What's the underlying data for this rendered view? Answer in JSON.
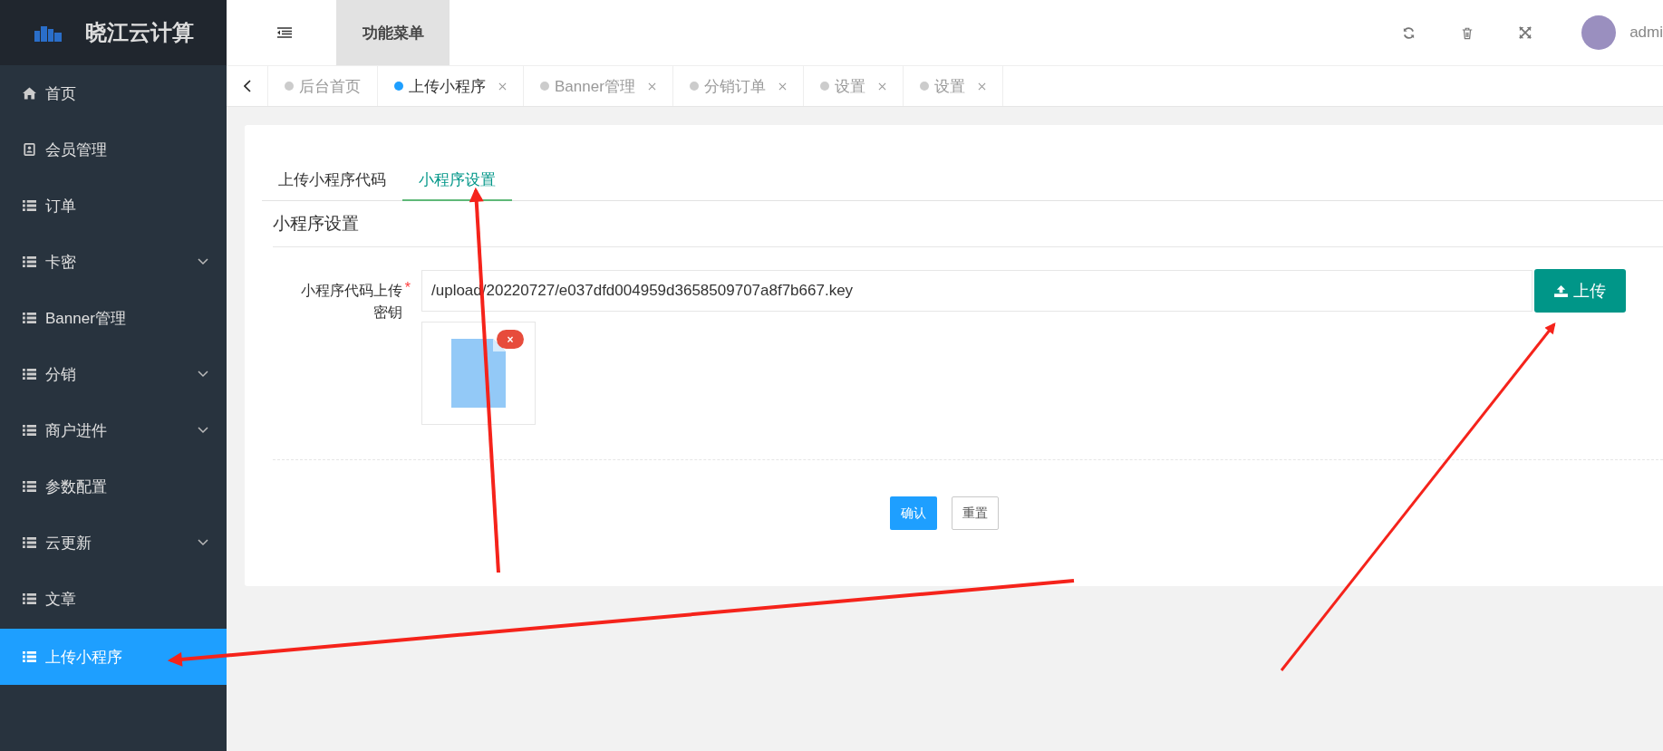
{
  "brand": {
    "title": "晓江云计算"
  },
  "header": {
    "menu_label": "功能菜单",
    "user": "admi"
  },
  "sidebar": {
    "items": [
      {
        "label": "首页",
        "kind": "home",
        "expandable": false,
        "selected": false
      },
      {
        "label": "会员管理",
        "kind": "contact",
        "expandable": false,
        "selected": false
      },
      {
        "label": "订单",
        "kind": "list",
        "expandable": false,
        "selected": false
      },
      {
        "label": "卡密",
        "kind": "list",
        "expandable": true,
        "selected": false
      },
      {
        "label": "Banner管理",
        "kind": "list",
        "expandable": false,
        "selected": false
      },
      {
        "label": "分销",
        "kind": "list",
        "expandable": true,
        "selected": false
      },
      {
        "label": "商户进件",
        "kind": "list",
        "expandable": true,
        "selected": false
      },
      {
        "label": "参数配置",
        "kind": "list",
        "expandable": false,
        "selected": false
      },
      {
        "label": "云更新",
        "kind": "list",
        "expandable": true,
        "selected": false
      },
      {
        "label": "文章",
        "kind": "list",
        "expandable": false,
        "selected": false
      },
      {
        "label": "上传小程序",
        "kind": "list",
        "expandable": false,
        "selected": true
      }
    ]
  },
  "page_tabs": [
    {
      "label": "后台首页",
      "selected": false,
      "closable": false
    },
    {
      "label": "上传小程序",
      "selected": true,
      "closable": true
    },
    {
      "label": "Banner管理",
      "selected": false,
      "closable": true
    },
    {
      "label": "分销订单",
      "selected": false,
      "closable": true
    },
    {
      "label": "设置",
      "selected": false,
      "closable": true
    },
    {
      "label": "设置",
      "selected": false,
      "closable": true
    }
  ],
  "content": {
    "tabs": [
      {
        "label": "上传小程序代码",
        "selected": false
      },
      {
        "label": "小程序设置",
        "selected": true
      }
    ],
    "section_title": "小程序设置",
    "field": {
      "label": "小程序代码上传密钥",
      "required_mark": "*",
      "value": "/upload/20220727/e037dfd004959d3658509707a8f7b667.key",
      "upload_button": "上传",
      "remove_badge": "×"
    },
    "buttons": [
      {
        "label": "确认",
        "kind": "primary"
      },
      {
        "label": "重置",
        "kind": "secondary"
      }
    ]
  }
}
